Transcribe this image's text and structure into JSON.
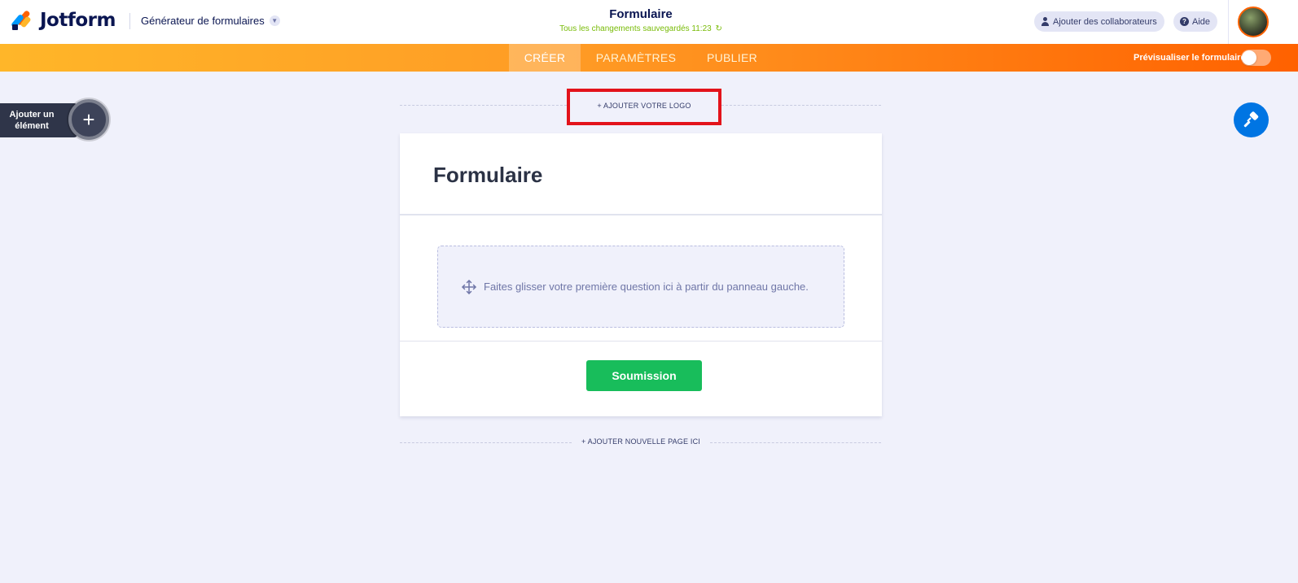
{
  "header": {
    "brand": "Jotform",
    "builder_menu_label": "Générateur de formulaires",
    "form_title": "Formulaire",
    "save_status": "Tous les changements sauvegardés 11:23",
    "collaborators_label": "Ajouter des collaborateurs",
    "help_label": "Aide"
  },
  "nav": {
    "tabs": [
      {
        "label": "CRÉER",
        "active": true
      },
      {
        "label": "PARAMÈTRES",
        "active": false
      },
      {
        "label": "PUBLIER",
        "active": false
      }
    ],
    "preview_label": "Prévisualiser le formulaire",
    "preview_enabled": false
  },
  "sidebar": {
    "add_element_label": "Ajouter un élément"
  },
  "canvas": {
    "add_logo_label": "+ AJOUTER VOTRE LOGO",
    "form_heading": "Formulaire",
    "dropzone_text": "Faites glisser votre première question ici à partir du panneau gauche.",
    "submit_label": "Soumission",
    "add_page_label": "+ AJOUTER NOUVELLE PAGE ICI"
  },
  "colors": {
    "accent_orange": "#ff6100",
    "submit_green": "#18bd5b",
    "designer_blue": "#0075e3",
    "highlight_red": "#e3131b"
  },
  "icons": {
    "brand": "jotform-logo-icon",
    "user": "user-icon",
    "help": "help-icon",
    "refresh": "refresh-icon",
    "add": "plus-icon",
    "designer": "paint-roller-icon",
    "move": "move-arrows-icon"
  }
}
